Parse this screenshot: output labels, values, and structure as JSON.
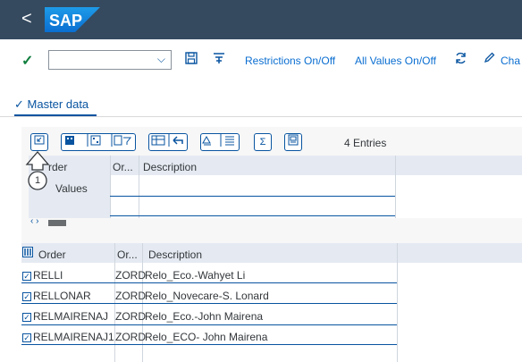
{
  "shell": {
    "back_glyph": "<",
    "logo_text": "SAP",
    "brand_color": "#0a6ed1"
  },
  "toolbar": {
    "command_value": "",
    "restrictions_label": "Restrictions On/Off",
    "all_values_label": "All Values On/Off",
    "change_label": "Cha"
  },
  "tab": {
    "label": "Master data"
  },
  "grid_toolbar": {
    "entries_label": "4 Entries"
  },
  "tooltip": {
    "number": "1"
  },
  "top_grid": {
    "headers": [
      "rder",
      "Or...",
      "Description"
    ],
    "row1_label": "Values"
  },
  "bottom_grid": {
    "headers": [
      "Order",
      "Or...",
      "Description"
    ],
    "rows": [
      {
        "order": "RELLI",
        "type": "ZORD",
        "description": "Relo_Eco.-Wahyet Li",
        "checked": true
      },
      {
        "order": "RELLONAR",
        "type": "ZORD",
        "description": "Relo_Novecare-S. Lonard",
        "checked": true
      },
      {
        "order": "RELMAIRENAJ",
        "type": "ZORD",
        "description": "Relo_Eco.-John Mairena",
        "checked": true
      },
      {
        "order": "RELMAIRENAJ1",
        "type": "ZORD",
        "description": "Relo_ECO- John Mairena",
        "checked": true
      }
    ]
  }
}
